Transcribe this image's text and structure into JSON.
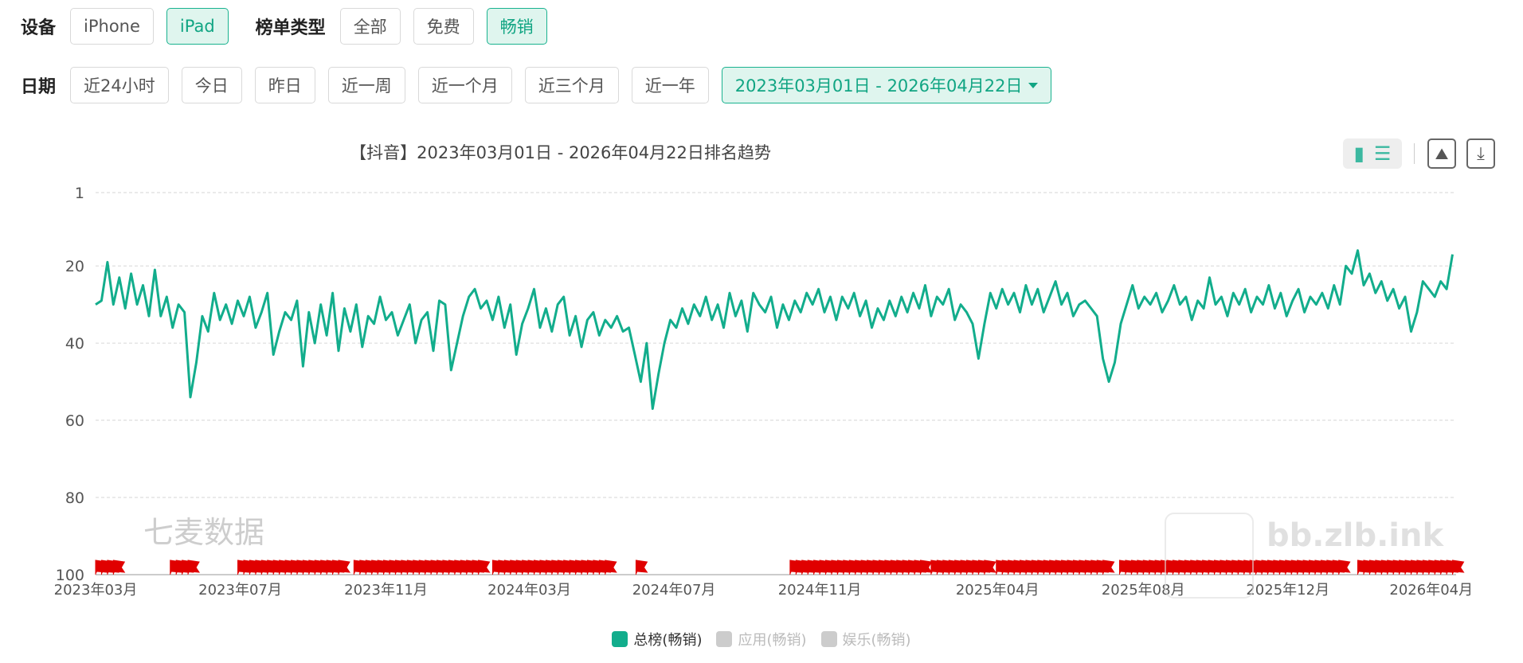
{
  "filters": {
    "device_label": "设备",
    "devices": [
      {
        "label": "iPhone",
        "active": false
      },
      {
        "label": "iPad",
        "active": true
      }
    ],
    "rank_type_label": "榜单类型",
    "rank_types": [
      {
        "label": "全部",
        "active": false
      },
      {
        "label": "免费",
        "active": false
      },
      {
        "label": "畅销",
        "active": true
      }
    ],
    "date_label": "日期",
    "dates": [
      {
        "label": "近24小时",
        "active": false
      },
      {
        "label": "今日",
        "active": false
      },
      {
        "label": "昨日",
        "active": false
      },
      {
        "label": "近一周",
        "active": false
      },
      {
        "label": "近一个月",
        "active": false
      },
      {
        "label": "近三个月",
        "active": false
      },
      {
        "label": "近一年",
        "active": false
      }
    ],
    "date_range": "2023年03月01日 - 2026年04月22日"
  },
  "toolbar": {
    "view_toggle_icon": "bar-list-toggle-icon",
    "image_icon": "image-icon",
    "download_icon": "download-icon"
  },
  "watermarks": {
    "left": "七麦数据",
    "right": "bb.zlb.ink"
  },
  "colors": {
    "accent": "#11a583",
    "line": "#12ad8c",
    "flag": "#e00000",
    "legend_inactive": "#cccccc"
  },
  "chart_data": {
    "type": "line",
    "title": "【抖音】2023年03月01日 - 2026年04月22日排名趋势",
    "y_inverted": true,
    "ylim": [
      1,
      100
    ],
    "y_ticks": [
      "1",
      "20",
      "40",
      "60",
      "80",
      "100"
    ],
    "y_tick_values": [
      1,
      20,
      40,
      60,
      80,
      100
    ],
    "x_ticks": [
      "2023年03月",
      "2023年07月",
      "2023年11月",
      "2024年03月",
      "2024年07月",
      "2024年11月",
      "2025年04月",
      "2025年08月",
      "2025年12月",
      "2026年04月"
    ],
    "x_tick_values": [
      0,
      122,
      245,
      366,
      488,
      611,
      761,
      884,
      1006,
      1127
    ],
    "x_range": [
      0,
      1148
    ],
    "grid": true,
    "legend_position": "bottom",
    "series": [
      {
        "name": "总榜(畅销)",
        "color": "#12ad8c",
        "visible": true,
        "points": [
          [
            0,
            30
          ],
          [
            5,
            29
          ],
          [
            10,
            19
          ],
          [
            15,
            30
          ],
          [
            20,
            23
          ],
          [
            25,
            31
          ],
          [
            30,
            22
          ],
          [
            35,
            30
          ],
          [
            40,
            25
          ],
          [
            45,
            33
          ],
          [
            50,
            21
          ],
          [
            55,
            33
          ],
          [
            60,
            28
          ],
          [
            65,
            36
          ],
          [
            70,
            30
          ],
          [
            75,
            32
          ],
          [
            80,
            54
          ],
          [
            85,
            45
          ],
          [
            90,
            33
          ],
          [
            95,
            37
          ],
          [
            100,
            27
          ],
          [
            105,
            34
          ],
          [
            110,
            30
          ],
          [
            115,
            35
          ],
          [
            120,
            29
          ],
          [
            125,
            33
          ],
          [
            130,
            28
          ],
          [
            135,
            36
          ],
          [
            140,
            32
          ],
          [
            145,
            27
          ],
          [
            150,
            43
          ],
          [
            155,
            37
          ],
          [
            160,
            32
          ],
          [
            165,
            34
          ],
          [
            170,
            29
          ],
          [
            175,
            46
          ],
          [
            180,
            32
          ],
          [
            185,
            40
          ],
          [
            190,
            30
          ],
          [
            195,
            38
          ],
          [
            200,
            27
          ],
          [
            205,
            42
          ],
          [
            210,
            31
          ],
          [
            215,
            37
          ],
          [
            220,
            30
          ],
          [
            225,
            41
          ],
          [
            230,
            33
          ],
          [
            235,
            35
          ],
          [
            240,
            28
          ],
          [
            245,
            34
          ],
          [
            250,
            32
          ],
          [
            255,
            38
          ],
          [
            260,
            34
          ],
          [
            265,
            30
          ],
          [
            270,
            40
          ],
          [
            275,
            34
          ],
          [
            280,
            32
          ],
          [
            285,
            42
          ],
          [
            290,
            29
          ],
          [
            295,
            30
          ],
          [
            300,
            47
          ],
          [
            305,
            40
          ],
          [
            310,
            33
          ],
          [
            315,
            28
          ],
          [
            320,
            26
          ],
          [
            325,
            31
          ],
          [
            330,
            29
          ],
          [
            335,
            34
          ],
          [
            340,
            28
          ],
          [
            345,
            36
          ],
          [
            350,
            30
          ],
          [
            355,
            43
          ],
          [
            360,
            35
          ],
          [
            365,
            31
          ],
          [
            370,
            26
          ],
          [
            375,
            36
          ],
          [
            380,
            31
          ],
          [
            385,
            37
          ],
          [
            390,
            30
          ],
          [
            395,
            28
          ],
          [
            400,
            38
          ],
          [
            405,
            33
          ],
          [
            410,
            41
          ],
          [
            415,
            34
          ],
          [
            420,
            32
          ],
          [
            425,
            38
          ],
          [
            430,
            34
          ],
          [
            435,
            36
          ],
          [
            440,
            33
          ],
          [
            445,
            37
          ],
          [
            450,
            36
          ],
          [
            455,
            43
          ],
          [
            460,
            50
          ],
          [
            465,
            40
          ],
          [
            470,
            57
          ],
          [
            475,
            48
          ],
          [
            480,
            40
          ],
          [
            485,
            34
          ],
          [
            490,
            36
          ],
          [
            495,
            31
          ],
          [
            500,
            35
          ],
          [
            505,
            30
          ],
          [
            510,
            33
          ],
          [
            515,
            28
          ],
          [
            520,
            34
          ],
          [
            525,
            30
          ],
          [
            530,
            36
          ],
          [
            535,
            27
          ],
          [
            540,
            33
          ],
          [
            545,
            29
          ],
          [
            550,
            37
          ],
          [
            555,
            27
          ],
          [
            560,
            30
          ],
          [
            565,
            32
          ],
          [
            570,
            28
          ],
          [
            575,
            36
          ],
          [
            580,
            30
          ],
          [
            585,
            34
          ],
          [
            590,
            29
          ],
          [
            595,
            32
          ],
          [
            600,
            27
          ],
          [
            605,
            30
          ],
          [
            610,
            26
          ],
          [
            615,
            32
          ],
          [
            620,
            28
          ],
          [
            625,
            34
          ],
          [
            630,
            28
          ],
          [
            635,
            31
          ],
          [
            640,
            27
          ],
          [
            645,
            33
          ],
          [
            650,
            29
          ],
          [
            655,
            36
          ],
          [
            660,
            31
          ],
          [
            665,
            34
          ],
          [
            670,
            29
          ],
          [
            675,
            33
          ],
          [
            680,
            28
          ],
          [
            685,
            32
          ],
          [
            690,
            27
          ],
          [
            695,
            31
          ],
          [
            700,
            25
          ],
          [
            705,
            33
          ],
          [
            710,
            28
          ],
          [
            715,
            30
          ],
          [
            720,
            26
          ],
          [
            725,
            34
          ],
          [
            730,
            30
          ],
          [
            735,
            32
          ],
          [
            740,
            35
          ],
          [
            745,
            44
          ],
          [
            750,
            35
          ],
          [
            755,
            27
          ],
          [
            760,
            31
          ],
          [
            765,
            26
          ],
          [
            770,
            30
          ],
          [
            775,
            27
          ],
          [
            780,
            32
          ],
          [
            785,
            25
          ],
          [
            790,
            30
          ],
          [
            795,
            26
          ],
          [
            800,
            32
          ],
          [
            805,
            28
          ],
          [
            810,
            24
          ],
          [
            815,
            30
          ],
          [
            820,
            27
          ],
          [
            825,
            33
          ],
          [
            830,
            30
          ],
          [
            835,
            29
          ],
          [
            840,
            31
          ],
          [
            845,
            33
          ],
          [
            850,
            44
          ],
          [
            855,
            50
          ],
          [
            860,
            45
          ],
          [
            865,
            35
          ],
          [
            870,
            30
          ],
          [
            875,
            25
          ],
          [
            880,
            31
          ],
          [
            885,
            28
          ],
          [
            890,
            30
          ],
          [
            895,
            27
          ],
          [
            900,
            32
          ],
          [
            905,
            29
          ],
          [
            910,
            25
          ],
          [
            915,
            30
          ],
          [
            920,
            28
          ],
          [
            925,
            34
          ],
          [
            930,
            29
          ],
          [
            935,
            31
          ],
          [
            940,
            23
          ],
          [
            945,
            30
          ],
          [
            950,
            28
          ],
          [
            955,
            33
          ],
          [
            960,
            27
          ],
          [
            965,
            30
          ],
          [
            970,
            26
          ],
          [
            975,
            32
          ],
          [
            980,
            28
          ],
          [
            985,
            30
          ],
          [
            990,
            25
          ],
          [
            995,
            31
          ],
          [
            1000,
            27
          ],
          [
            1005,
            33
          ],
          [
            1010,
            29
          ],
          [
            1015,
            26
          ],
          [
            1020,
            32
          ],
          [
            1025,
            28
          ],
          [
            1030,
            30
          ],
          [
            1035,
            27
          ],
          [
            1040,
            31
          ],
          [
            1045,
            25
          ],
          [
            1050,
            30
          ],
          [
            1055,
            20
          ],
          [
            1060,
            22
          ],
          [
            1065,
            16
          ],
          [
            1070,
            25
          ],
          [
            1075,
            22
          ],
          [
            1080,
            27
          ],
          [
            1085,
            24
          ],
          [
            1090,
            29
          ],
          [
            1095,
            26
          ],
          [
            1100,
            31
          ],
          [
            1105,
            28
          ],
          [
            1110,
            37
          ],
          [
            1115,
            32
          ],
          [
            1120,
            24
          ],
          [
            1125,
            26
          ],
          [
            1130,
            28
          ],
          [
            1135,
            24
          ],
          [
            1140,
            26
          ],
          [
            1145,
            17
          ]
        ]
      },
      {
        "name": "应用(畅销)",
        "color": "#cccccc",
        "visible": false,
        "points": []
      },
      {
        "name": "娱乐(畅销)",
        "color": "#cccccc",
        "visible": false,
        "points": []
      }
    ],
    "event_markers": {
      "color": "#e00000",
      "y_value": 100,
      "ranges": [
        [
          0,
          16
        ],
        [
          63,
          78
        ],
        [
          120,
          208
        ],
        [
          218,
          325
        ],
        [
          335,
          432
        ],
        [
          456,
          460
        ],
        [
          586,
          698
        ],
        [
          705,
          752
        ],
        [
          760,
          852
        ],
        [
          864,
          1050
        ],
        [
          1065,
          1148
        ]
      ]
    }
  }
}
